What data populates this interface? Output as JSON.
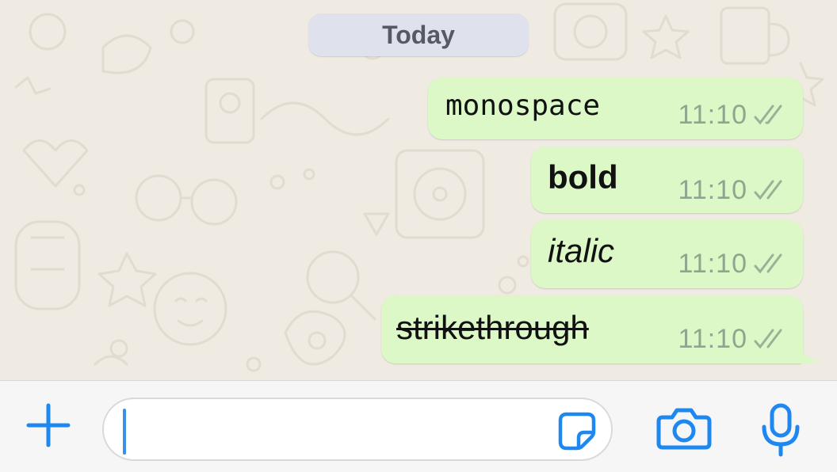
{
  "date_separator": "Today",
  "messages": [
    {
      "text": "monospace",
      "time": "11:10",
      "format": "monospace",
      "status": "read"
    },
    {
      "text": "bold",
      "time": "11:10",
      "format": "bold",
      "status": "read"
    },
    {
      "text": "italic",
      "time": "11:10",
      "format": "italic",
      "status": "read"
    },
    {
      "text": "strikethrough",
      "time": "11:10",
      "format": "strikethrough",
      "status": "read"
    }
  ],
  "composer": {
    "value": "",
    "icons": [
      "plus-icon",
      "sticker-icon",
      "camera-icon",
      "microphone-icon"
    ]
  },
  "colors": {
    "outgoing_bubble": "#dcf8c6",
    "accent": "#1f87f0",
    "chat_background": "#efeae2",
    "date_pill": "#dfe1ec"
  }
}
